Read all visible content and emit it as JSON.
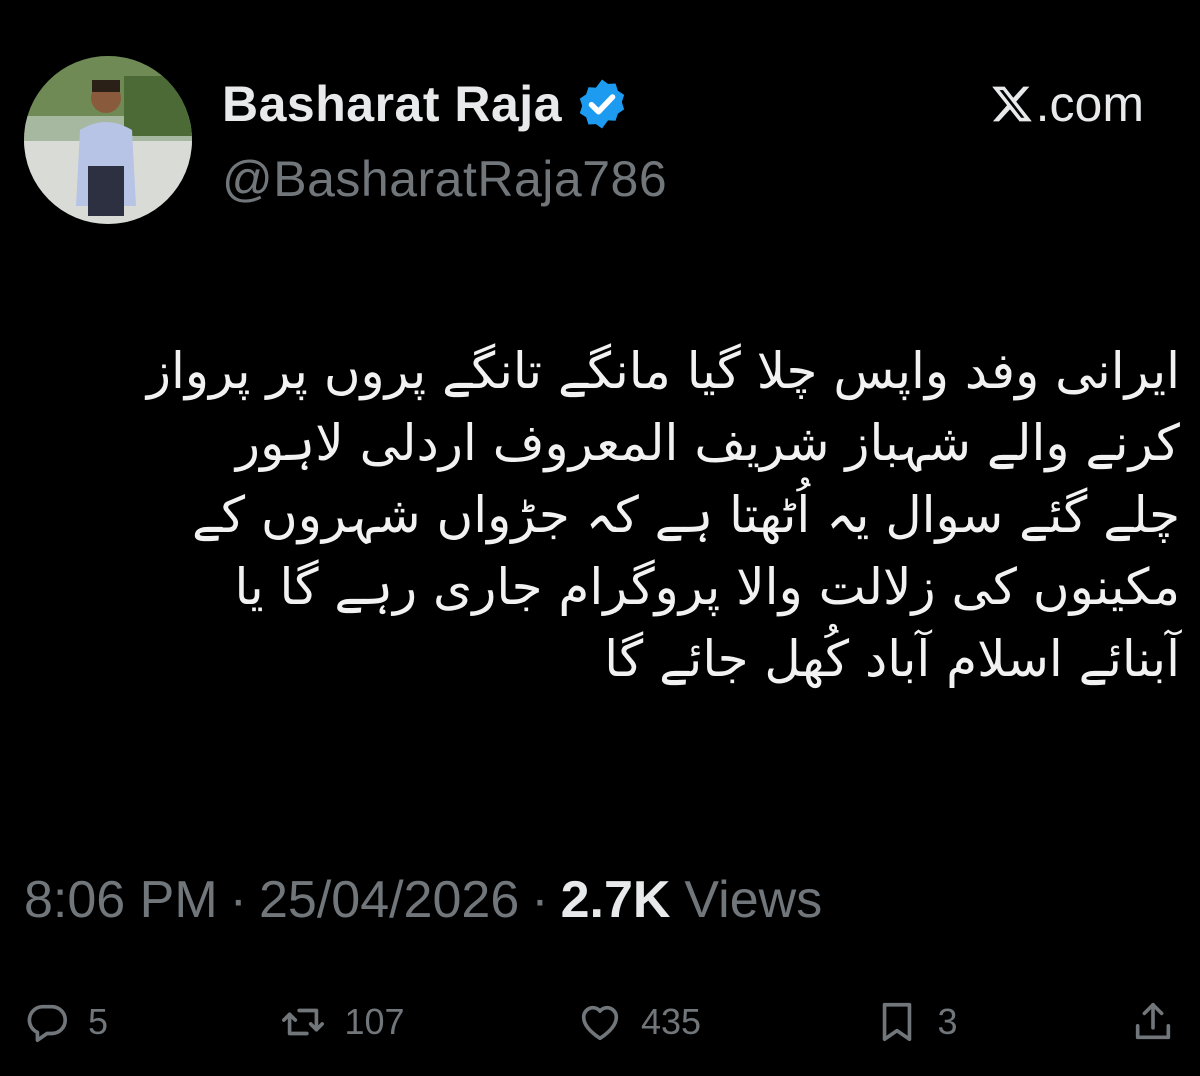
{
  "author": {
    "display_name": "Basharat Raja",
    "handle": "@BasharatRaja786",
    "verified_icon": "verified-badge-icon"
  },
  "brand": {
    "logo_icon": "x-logo-icon",
    "text": ".com"
  },
  "tweet": {
    "lines": [
      "ایرانی وفد واپس چلا گیا مانگے تانگے پروں پر پرواز",
      "کرنے والے شہباز شریف المعروف اردلی لاہور",
      "چلے گئے سوال یہ اُٹھتا ہے کہ جڑواں شہروں کے",
      "مکینوں کی زلالت والا پروگرام جاری رہے گا یا",
      "آبنائے اسلام آباد کُھل جائے گا"
    ]
  },
  "meta": {
    "time": "8:06 PM",
    "date": "25/04/2026",
    "views_count": "2.7K",
    "views_label": "Views"
  },
  "actions": {
    "replies": "5",
    "reposts": "107",
    "likes": "435",
    "bookmarks": "3"
  },
  "colors": {
    "background": "#000000",
    "primary_text": "#e7e9ea",
    "secondary_text": "#71767b",
    "verified_blue": "#1d9bf0"
  }
}
